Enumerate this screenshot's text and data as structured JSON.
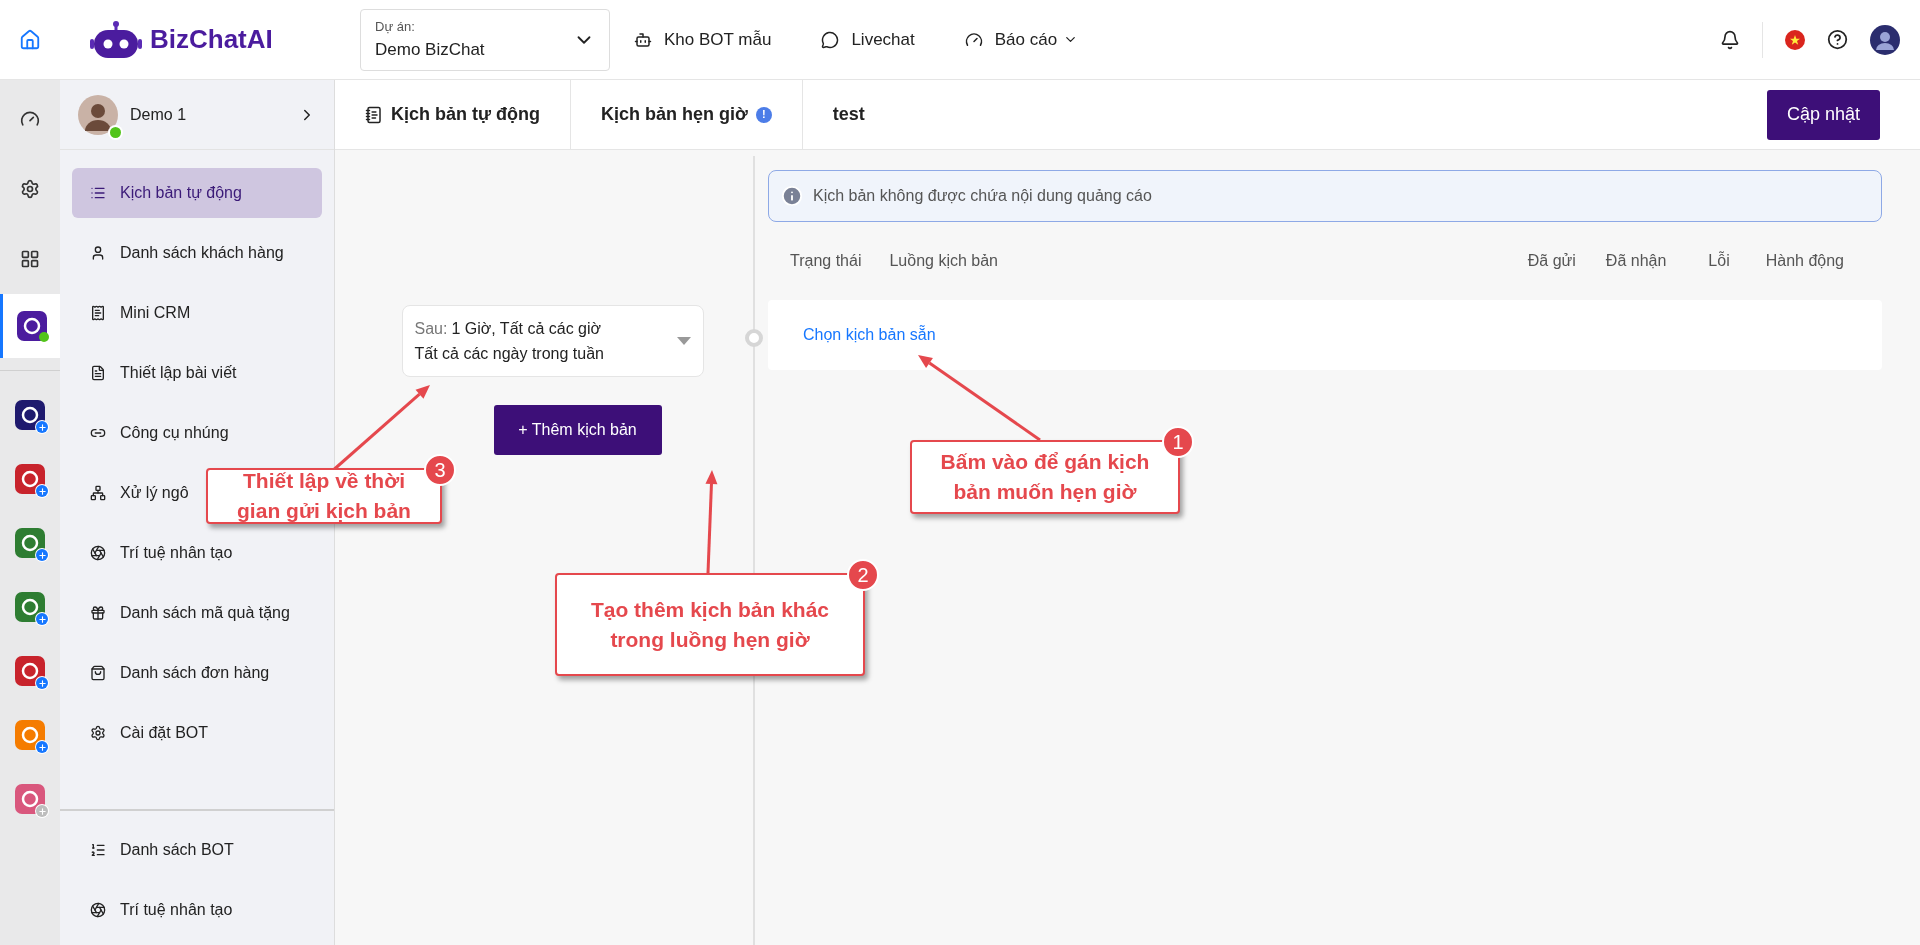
{
  "logo": {
    "text": "BizChatAI"
  },
  "project": {
    "label": "Dự án:",
    "value": "Demo BizChat"
  },
  "nav": [
    {
      "label": "Kho BOT mẫu",
      "dropdown": false
    },
    {
      "label": "Livechat",
      "dropdown": false
    },
    {
      "label": "Báo cáo",
      "dropdown": true
    }
  ],
  "rail": {
    "apps": [
      {
        "kind": "online",
        "color": "#4b1c9e",
        "selected": true
      },
      {
        "kind": "add",
        "color": "#1f1a6e",
        "selected": false
      },
      {
        "kind": "add",
        "color": "#c8232c",
        "selected": false
      },
      {
        "kind": "add",
        "color": "#2e7d32",
        "selected": false
      },
      {
        "kind": "add",
        "color": "#2e7d32",
        "selected": false
      },
      {
        "kind": "add",
        "color": "#c8232c",
        "selected": false
      },
      {
        "kind": "add",
        "color": "#f57c00",
        "selected": false
      },
      {
        "kind": "inactive",
        "color": "#d9577d",
        "selected": false
      }
    ]
  },
  "account": {
    "name": "Demo 1",
    "online": true
  },
  "menu": [
    {
      "label": "Kịch bản tự động",
      "selected": true
    },
    {
      "label": "Danh sách khách hàng",
      "selected": false
    },
    {
      "label": "Mini CRM",
      "selected": false
    },
    {
      "label": "Thiết lập bài viết",
      "selected": false
    },
    {
      "label": "Công cụ nhúng",
      "selected": false
    },
    {
      "label": "Xử lý ngô",
      "selected": false
    },
    {
      "label": "Trí tuệ nhân tạo",
      "selected": false
    },
    {
      "label": "Danh sách mã quà tặng",
      "selected": false
    },
    {
      "label": "Danh sách đơn hàng",
      "selected": false
    },
    {
      "label": "Cài đặt BOT",
      "selected": false
    }
  ],
  "menu_bottom": [
    {
      "label": "Danh sách BOT",
      "selected": false
    },
    {
      "label": "Trí tuệ nhân tạo",
      "selected": false
    }
  ],
  "breadcrumb": [
    {
      "label": "Kịch bản tự động",
      "icon": true,
      "info": false
    },
    {
      "label": "Kịch bản hẹn giờ",
      "icon": false,
      "info": true
    },
    {
      "label": "test",
      "icon": false,
      "info": false
    }
  ],
  "info_badge": "!",
  "update_button": "Cập nhật",
  "schedule": {
    "prefix": "Sau:",
    "value": "1 Giờ, Tất cả các giờ",
    "days": "Tất cả các ngày trong tuần"
  },
  "add_button": "+ Thêm kịch bản",
  "notice": "Kịch bản không được chứa nội dung quảng cáo",
  "table": {
    "columns": [
      "Trạng thái",
      "Luồng kịch bản",
      "Đã gửi",
      "Đã nhận",
      "Lỗi",
      "Hành động"
    ],
    "link": "Chọn kịch bản sẵn"
  },
  "annotations": [
    {
      "number": "1",
      "text": "Bấm vào để gán kịch bản muốn hẹn giờ"
    },
    {
      "number": "2",
      "text": "Tạo thêm kịch bản khác trong luồng hẹn giờ"
    },
    {
      "number": "3",
      "text": "Thiết lập về thời gian gửi kịch bản"
    }
  ]
}
